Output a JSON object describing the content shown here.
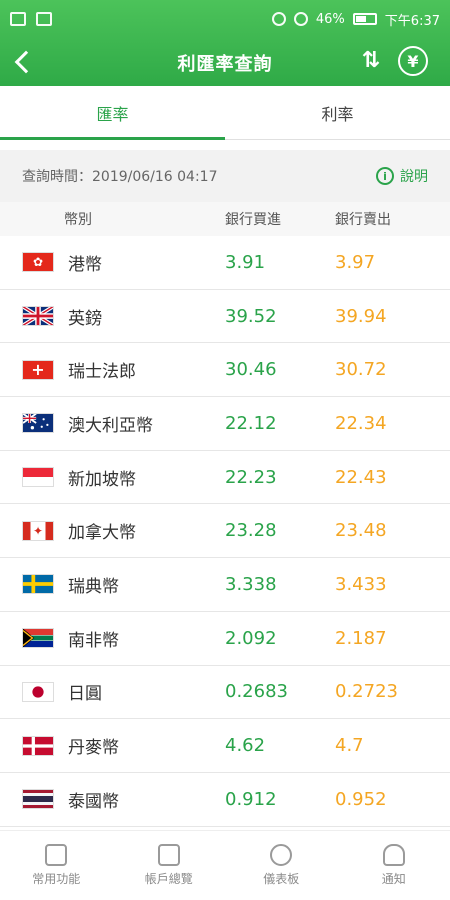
{
  "status": {
    "battery": "46%",
    "time": "下午6:37"
  },
  "header": {
    "title": "利匯率查詢"
  },
  "tabs": [
    {
      "label": "匯率"
    },
    {
      "label": "利率"
    }
  ],
  "query": {
    "time": "查詢時間：2019/06/16 04:17",
    "info_label": "說明"
  },
  "columns": {
    "currency": "幣別",
    "buy": "銀行買進",
    "sell": "銀行賣出"
  },
  "rates": [
    {
      "name": "港幣",
      "buy": "3.91",
      "sell": "3.97"
    },
    {
      "name": "英鎊",
      "buy": "39.52",
      "sell": "39.94"
    },
    {
      "name": "瑞士法郎",
      "buy": "30.46",
      "sell": "30.72"
    },
    {
      "name": "澳大利亞幣",
      "buy": "22.12",
      "sell": "22.34"
    },
    {
      "name": "新加坡幣",
      "buy": "22.23",
      "sell": "22.43"
    },
    {
      "name": "加拿大幣",
      "buy": "23.28",
      "sell": "23.48"
    },
    {
      "name": "瑞典幣",
      "buy": "3.338",
      "sell": "3.433"
    },
    {
      "name": "南非幣",
      "buy": "2.092",
      "sell": "2.187"
    },
    {
      "name": "日圓",
      "buy": "0.2683",
      "sell": "0.2723"
    },
    {
      "name": "丹麥幣",
      "buy": "4.62",
      "sell": "4.7"
    },
    {
      "name": "泰國幣",
      "buy": "0.912",
      "sell": "0.952"
    }
  ],
  "bottom_nav": [
    {
      "label": "常用功能"
    },
    {
      "label": "帳戶總覽"
    },
    {
      "label": "儀表板"
    },
    {
      "label": "通知"
    }
  ],
  "colors": {
    "brand": "#2faa47",
    "buy": "#2aa34a",
    "sell": "#f4a623"
  }
}
